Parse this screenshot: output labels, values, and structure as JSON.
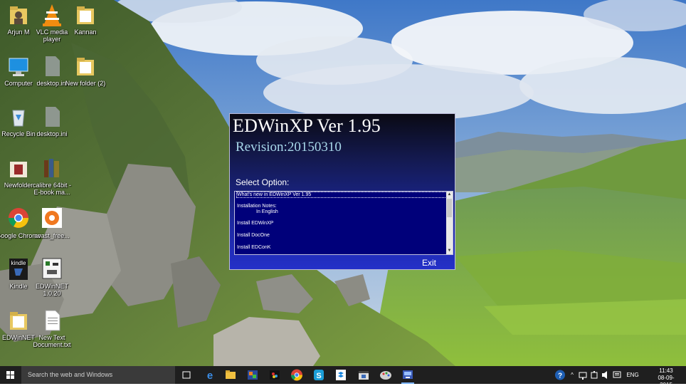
{
  "desktop": {
    "icons": [
      {
        "label": "Arjun M",
        "icon": "user-folder-icon"
      },
      {
        "label": "VLC media player",
        "icon": "vlc-cone-icon"
      },
      {
        "label": "Kannan",
        "icon": "folder-icon"
      },
      {
        "label": "Computer",
        "icon": "computer-icon"
      },
      {
        "label": "desktop.ini",
        "icon": "file-icon"
      },
      {
        "label": "New folder (2)",
        "icon": "folder-icon"
      },
      {
        "label": "Recycle Bin",
        "icon": "recycle-bin-icon"
      },
      {
        "label": "desktop.ini",
        "icon": "file-icon"
      },
      {
        "label": "Newfolder",
        "icon": "folder-icon"
      },
      {
        "label": "calibre 64bit - E-book ma...",
        "icon": "calibre-books-icon"
      },
      {
        "label": "Google Chrome",
        "icon": "chrome-icon"
      },
      {
        "label": "avast_free...",
        "icon": "avast-icon"
      },
      {
        "label": "Kindle",
        "icon": "kindle-icon"
      },
      {
        "label": "EDWinNET 1.0.20",
        "icon": "edwin-net-icon"
      },
      {
        "label": "EDWinNET",
        "icon": "folder-icon"
      },
      {
        "label": "New Text Document.txt",
        "icon": "text-file-icon"
      }
    ]
  },
  "installer": {
    "title": "EDWinXP Ver 1.95",
    "revision": "Revision:20150310",
    "select_label": "Select Option:",
    "options": [
      "What's new in EDWinXP Ver 1.95",
      "Installation Notes:",
      "In English",
      "Install EDWinXP",
      "Install DocOne",
      "Install EDConK"
    ],
    "exit_label": "Exit",
    "colors": {
      "list_bg": "#00007a",
      "revision": "#a8d8ea"
    }
  },
  "taskbar": {
    "search_placeholder": "Search the web and Windows",
    "apps": [
      "task-view-icon",
      "edge-icon",
      "file-explorer-icon",
      "photo-app-icon",
      "chrome-icon",
      "skype-icon",
      "dropbox-icon",
      "media-player-icon",
      "paint-icon",
      "installer-app-icon"
    ],
    "tray": {
      "language": "ENG",
      "time": "11:43",
      "date": "08-09-2015"
    }
  }
}
